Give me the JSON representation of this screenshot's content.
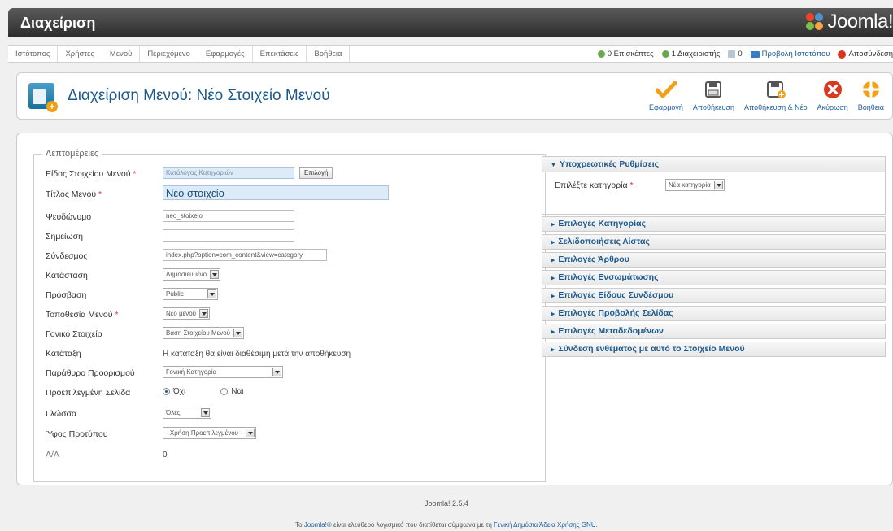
{
  "header": {
    "title": "Διαχείριση",
    "logo_text": "Joomla!"
  },
  "menu": [
    "Ιστότοπος",
    "Χρήστες",
    "Μενού",
    "Περιεχόμενο",
    "Εφαρμογές",
    "Επεκτάσεις",
    "Βοήθεια"
  ],
  "status": {
    "visitors": "0 Επισκέπτες",
    "admins": "1 Διαχειριστής",
    "messages": "0",
    "view_site": "Προβολή Ιστοτόπου",
    "logout": "Αποσύνδεση"
  },
  "toolbar": {
    "title": "Διαχείριση Μενού: Νέο Στοιχείο Μενού",
    "apply": "Εφαρμογή",
    "save": "Αποθήκευση",
    "save_new": "Αποθήκευση & Νέο",
    "cancel": "Ακύρωση",
    "help": "Βοήθεια"
  },
  "details": {
    "legend": "Λεπτομέρειες",
    "required_mark": "*",
    "item_type_label": "Είδος Στοιχείου Μενού",
    "item_type_value": "Κατάλογος Κατηγοριών",
    "select_button": "Επιλογή",
    "title_label": "Τίτλος Μενού",
    "title_value": "Νέο στοιχείο",
    "alias_label": "Ψευδώνυμο",
    "alias_value": "neo_stoixeio",
    "note_label": "Σημείωση",
    "note_value": "",
    "link_label": "Σύνδεσμος",
    "link_value": "index.php?option=com_content&view=category",
    "status_label": "Κατάσταση",
    "status_value": "Δημοσιευμένο",
    "access_label": "Πρόσβαση",
    "access_value": "Public",
    "menu_location_label": "Τοποθεσία Μενού",
    "menu_location_value": "Νέο μενού",
    "parent_label": "Γονικό Στοιχείο",
    "parent_value": "Βάση Στοιχείου Μενού",
    "ordering_label": "Κατάταξη",
    "ordering_value": "Η κατάταξη θα είναι διαθέσιμη μετά την αποθήκευση",
    "target_label": "Παράθυρο Προορισμού",
    "target_value": "Γονική Κατηγορία",
    "default_label": "Προεπιλεγμένη Σελίδα",
    "default_no": "Όχι",
    "default_yes": "Ναι",
    "language_label": "Γλώσσα",
    "language_value": "Όλες",
    "template_label": "Ύφος Προτύπου",
    "template_value": "- Χρήση Προεπιλεγμένου -",
    "id_label": "Α/Α",
    "id_value": "0"
  },
  "required_panel": {
    "title": "Υποχρεωτικές Ρυθμίσεις",
    "category_label": "Επιλέξτε κατηγορία",
    "category_value": "Νέα κατηγορία"
  },
  "panels": [
    "Επιλογές Κατηγορίας",
    "Σελιδοποιήσεις Λίστας",
    "Επιλογές Άρθρου",
    "Επιλογές Ενσωμάτωσης",
    "Επιλογές Είδους Συνδέσμου",
    "Επιλογές Προβολής Σελίδας",
    "Επιλογές Μεταδεδομένων",
    "Σύνδεση ενθέματος με αυτό το Στοιχείο Μενού"
  ],
  "footer": {
    "version": "Joomla! 2.5.4",
    "license_prefix": "Το",
    "joomla_link": "Joomla!®",
    "license_middle": "είναι ελεύθερο λογισμικό που διατίθεται σύμφωνα με τη",
    "license_link": "Γενική Δημόσια Άδεια Χρήσης GNU."
  },
  "colors": {
    "accent": "#1d5a8c",
    "required": "#ee3333",
    "header": "#3a3a3a"
  }
}
